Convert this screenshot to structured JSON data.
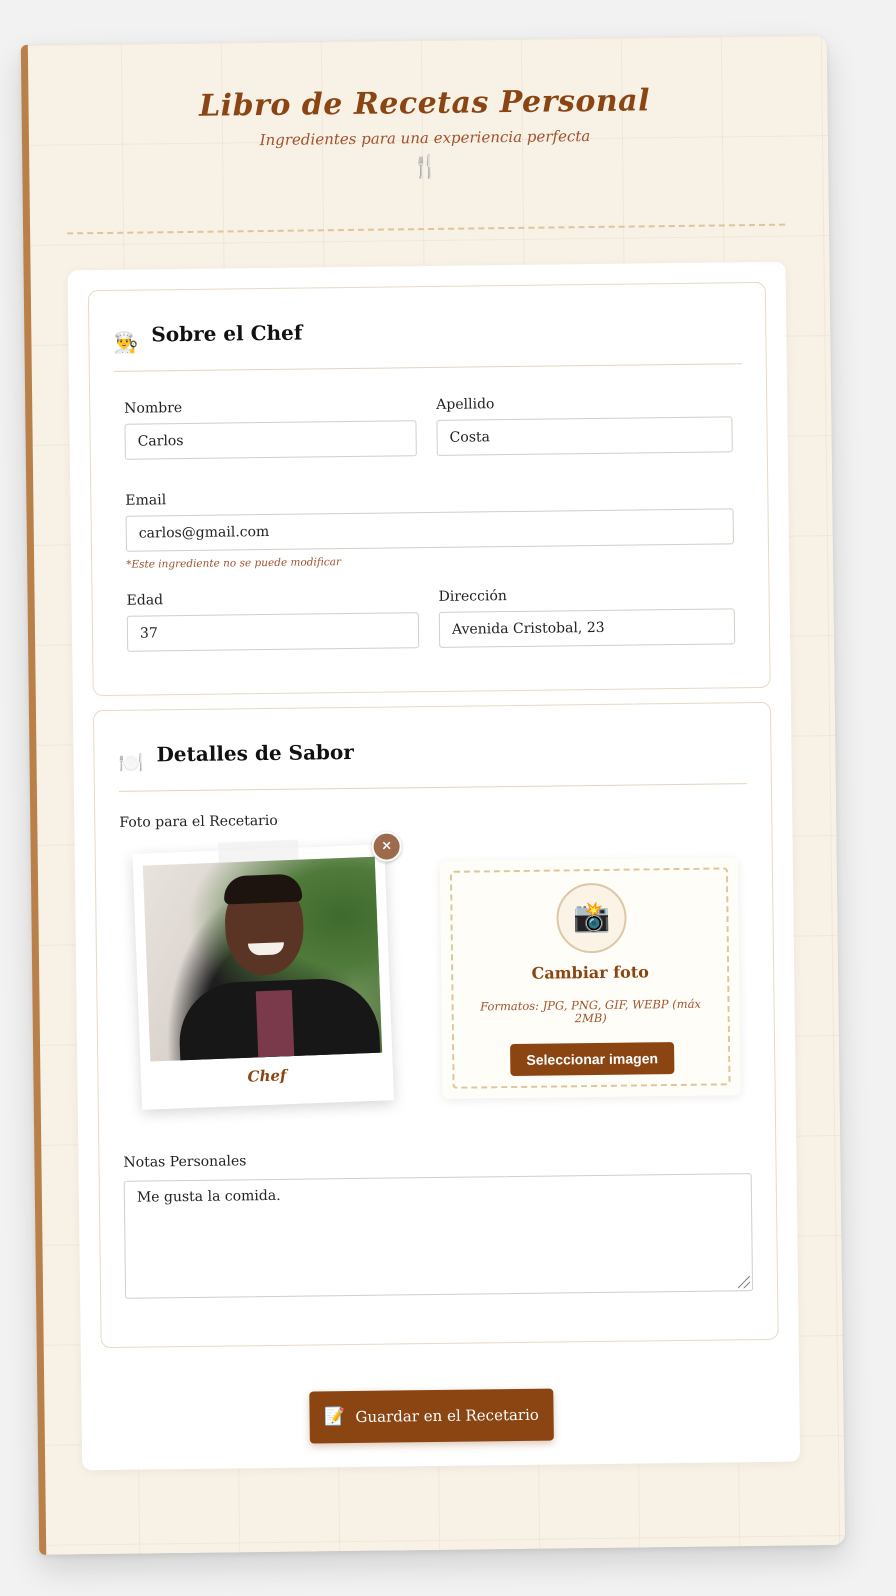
{
  "header": {
    "title": "Libro de Recetas Personal",
    "subtitle": "Ingredientes para una experiencia perfecta",
    "icon": "🍴"
  },
  "chef_section": {
    "icon": "👨‍🍳",
    "title": "Sobre el Chef",
    "fields": {
      "nombre": {
        "label": "Nombre",
        "value": "Carlos"
      },
      "apellido": {
        "label": "Apellido",
        "value": "Costa"
      },
      "email": {
        "label": "Email",
        "value": "carlos@gmail.com",
        "note": "*Este ingrediente no se puede modificar"
      },
      "edad": {
        "label": "Edad",
        "value": "37"
      },
      "direccion": {
        "label": "Dirección",
        "value": "Avenida Cristobal, 23"
      }
    }
  },
  "flavor_section": {
    "icon": "🍽️",
    "title": "Detalles de Sabor",
    "photo_label": "Foto para el Recetario",
    "polaroid_caption": "Chef",
    "remove_symbol": "×",
    "upload": {
      "camera_icon": "📸",
      "title": "Cambiar foto",
      "formats": "Formatos: JPG, PNG, GIF, WEBP (máx 2MB)",
      "button": "Seleccionar imagen"
    },
    "notes": {
      "label": "Notas Personales",
      "value": "Me gusta la comida."
    }
  },
  "save_button": {
    "icon": "📝",
    "label": "Guardar en el Recetario"
  },
  "colors": {
    "accent": "#8b4513",
    "accent_light": "#a0522d",
    "paper": "#f8f1e6",
    "dashed": "#e0c49c"
  }
}
